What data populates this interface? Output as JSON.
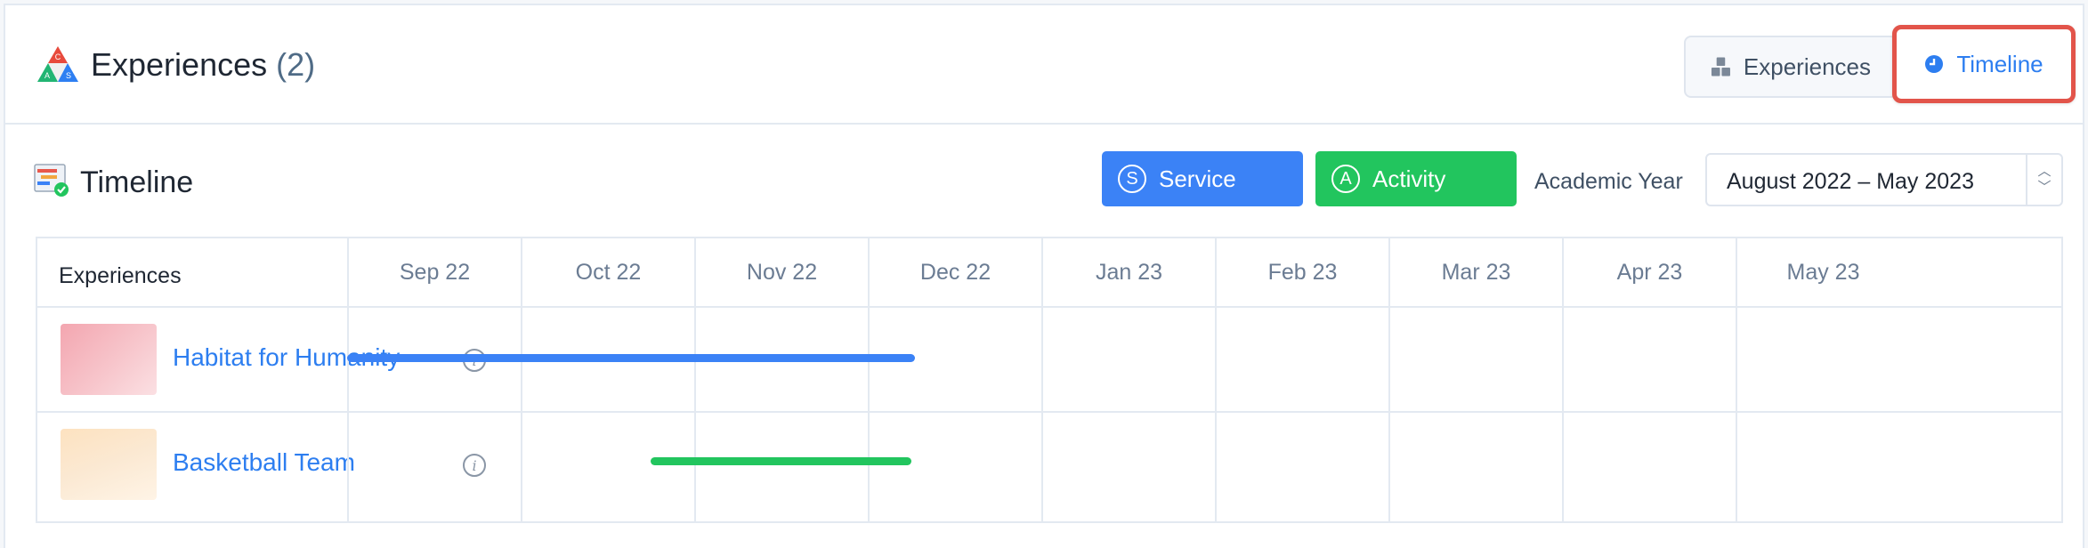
{
  "header": {
    "title": "Experiences",
    "count": "(2)",
    "logo_icon": "cas-triangle-icon"
  },
  "view_switch": {
    "experiences_label": "Experiences",
    "timeline_label": "Timeline",
    "active": "Timeline",
    "highlight_color": "#e2544a"
  },
  "timeline": {
    "title": "Timeline",
    "icon": "timeline-chart-icon",
    "legend": {
      "service": {
        "letter": "S",
        "label": "Service",
        "color": "#3b82f6"
      },
      "activity": {
        "letter": "A",
        "label": "Activity",
        "color": "#22c55e"
      }
    },
    "academic_year_label": "Academic Year",
    "academic_year_value": "August 2022 – May 2023"
  },
  "grid": {
    "experiences_header": "Experiences",
    "months": [
      "Sep 22",
      "Oct 22",
      "Nov 22",
      "Dec 22",
      "Jan 23",
      "Feb 23",
      "Mar 23",
      "Apr 23",
      "May 23"
    ],
    "rows": [
      {
        "name": "Habitat for Humanity",
        "type": "service",
        "start_month": 0,
        "end_month": 3.27,
        "color": "#3b82f6"
      },
      {
        "name": "Basketball Team",
        "type": "activity",
        "start_month": 1.75,
        "end_month": 3.25,
        "color": "#22c55e"
      }
    ]
  }
}
